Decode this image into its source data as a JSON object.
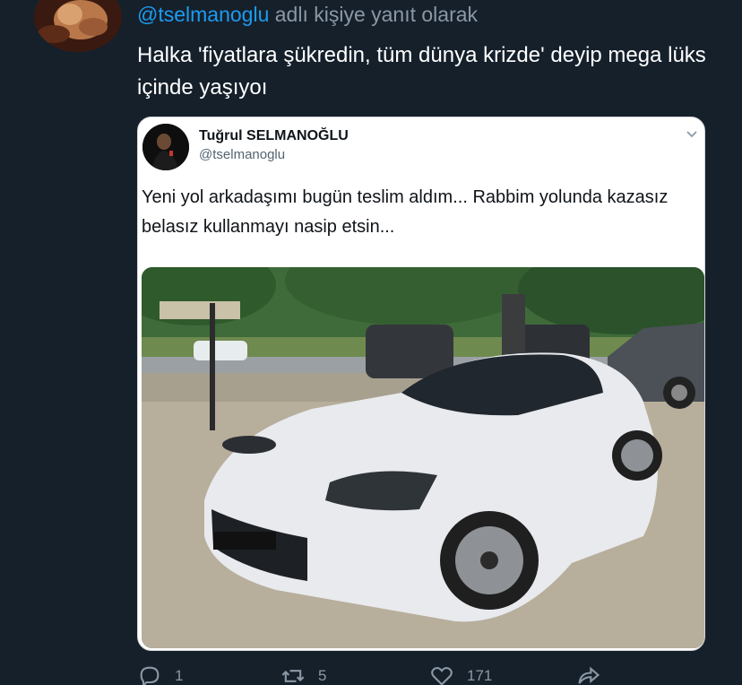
{
  "reply": {
    "handle": "@tselmanoglu",
    "suffix": "adlı kişiye yanıt olarak"
  },
  "tweet": {
    "text": "Halka 'fiyatlara şükredin, tüm dünya krizde' deyip mega lüks içinde yaşıyoı"
  },
  "quoted": {
    "name": "Tuğrul SELMANOĞLU",
    "handle": "@tselmanoglu",
    "text": "Yeni yol arkadaşımı bugün teslim aldım... Rabbim yolunda kazasız belasız kullanmayı nasip etsin..."
  },
  "actions": {
    "reply_count": "1",
    "retweet_count": "5",
    "like_count": "171"
  },
  "colors": {
    "background": "#15202b",
    "accent": "#1d9bf0",
    "muted": "#8b98a5"
  },
  "icons": [
    "reply-icon",
    "retweet-icon",
    "like-icon",
    "share-icon",
    "chevron-down-icon"
  ]
}
